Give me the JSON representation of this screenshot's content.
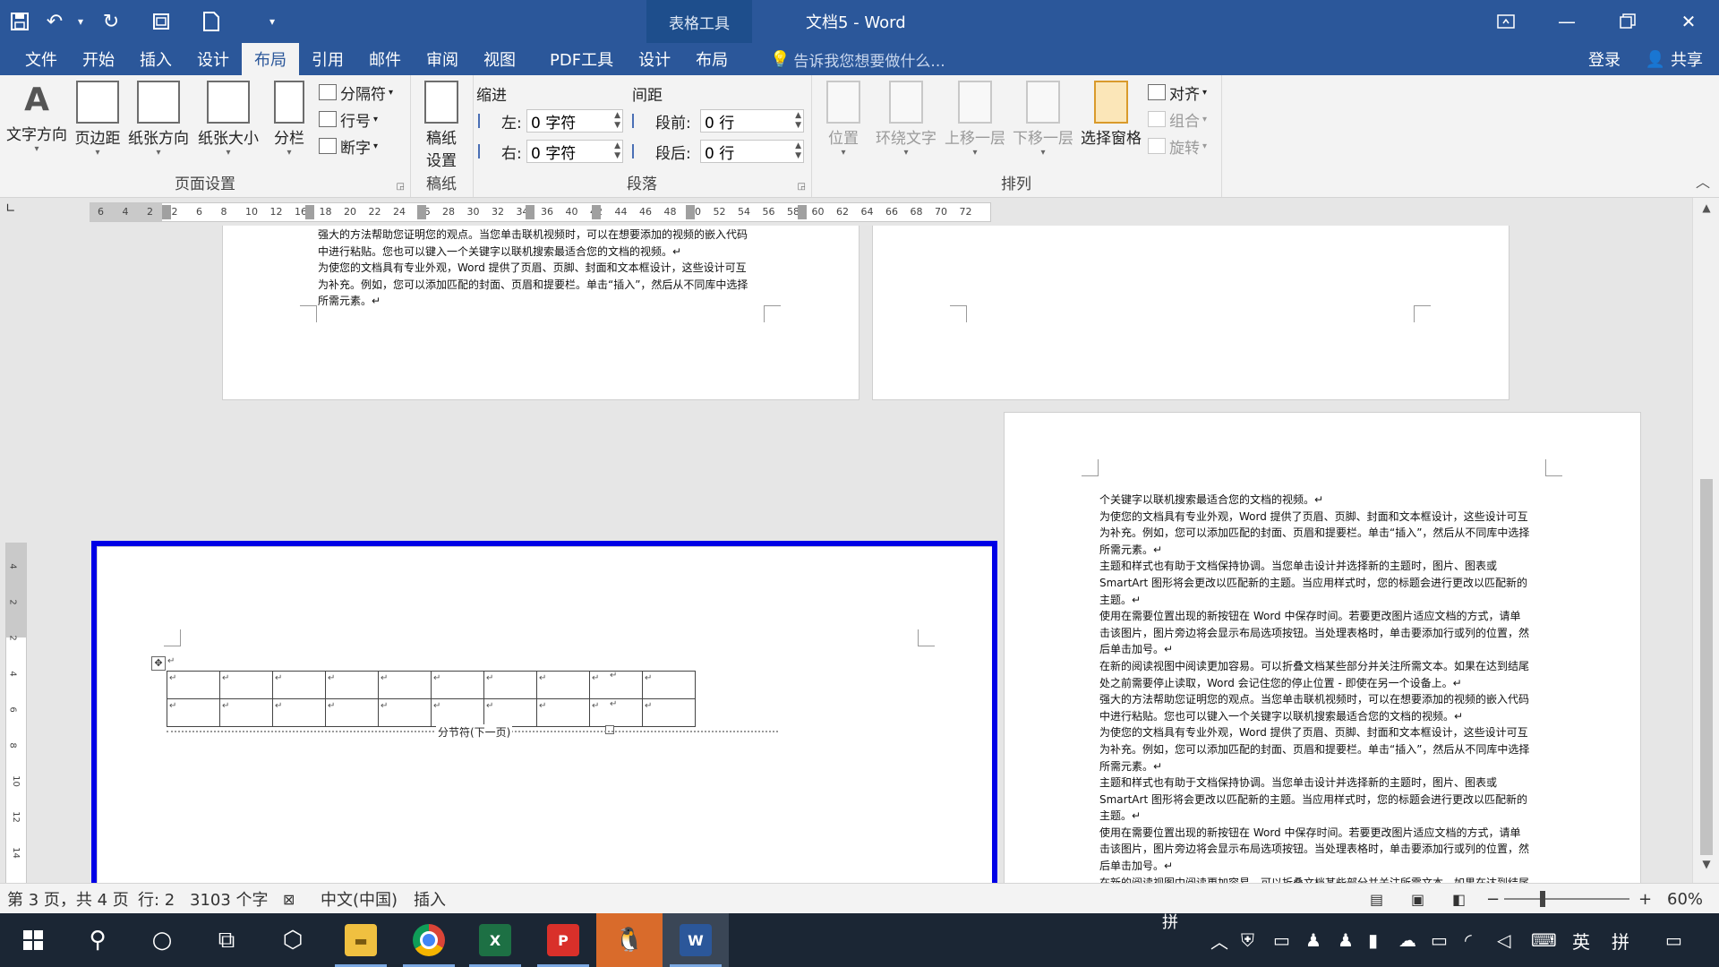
{
  "titlebar": {
    "context_tab": "表格工具",
    "title": "文档5 - Word"
  },
  "menu": {
    "tabs": [
      "文件",
      "开始",
      "插入",
      "设计",
      "布局",
      "引用",
      "邮件",
      "审阅",
      "视图",
      "PDF工具",
      "设计",
      "布局"
    ],
    "active_index": 4,
    "tell_me": "告诉我您想要做什么...",
    "sign_in": "登录",
    "share": "共享"
  },
  "ribbon": {
    "page_setup": {
      "label": "页面设置",
      "text_direction": "文字方向",
      "margins": "页边距",
      "orientation": "纸张方向",
      "size": "纸张大小",
      "columns": "分栏",
      "breaks": "分隔符",
      "line_numbers": "行号",
      "hyphenation": "断字"
    },
    "draft_paper": {
      "label": "稿纸",
      "button_line1": "稿纸",
      "button_line2": "设置"
    },
    "paragraph": {
      "label": "段落",
      "indent_title": "缩进",
      "spacing_title": "间距",
      "left_label": "左:",
      "left_value": "0 字符",
      "right_label": "右:",
      "right_value": "0 字符",
      "before_label": "段前:",
      "before_value": "0 行",
      "after_label": "段后:",
      "after_value": "0 行"
    },
    "arrange": {
      "label": "排列",
      "position": "位置",
      "wrap_text": "环绕文字",
      "bring_forward": "上移一层",
      "send_backward": "下移一层",
      "selection_pane": "选择窗格",
      "align": "对齐",
      "group": "组合",
      "rotate": "旋转"
    }
  },
  "ruler": {
    "ticks": [
      "6",
      "4",
      "2",
      "2",
      "6",
      "8",
      "10",
      "12",
      "16",
      "18",
      "20",
      "22",
      "24",
      "26",
      "28",
      "30",
      "32",
      "34",
      "36",
      "40",
      "42",
      "44",
      "46",
      "48",
      "50",
      "52",
      "54",
      "56",
      "58",
      "60",
      "62",
      "64",
      "66",
      "68",
      "70",
      "72"
    ]
  },
  "vruler": {
    "marks": [
      "4",
      "2",
      "2",
      "4",
      "6",
      "8",
      "10",
      "12",
      "14"
    ]
  },
  "pages": {
    "top_left_text": [
      "强大的方法帮助您证明您的观点。当您单击联机视频时，可以在想要添加的视频的嵌入代码",
      "中进行粘贴。您也可以键入一个关键字以联机搜索最适合您的文档的视频。↵",
      "为使您的文档具有专业外观，Word 提供了页眉、页脚、封面和文本框设计，这些设计可互",
      "为补充。例如，您可以添加匹配的封面、页眉和提要栏。单击“插入”，然后从不同库中选择",
      "所需元素。↵"
    ],
    "right_text": [
      "个关键字以联机搜索最适合您的文档的视频。↵",
      "为使您的文档具有专业外观，Word 提供了页眉、页脚、封面和文本框设计，这些设计可互",
      "为补充。例如，您可以添加匹配的封面、页眉和提要栏。单击“插入”，然后从不同库中选择",
      "所需元素。↵",
      "主题和样式也有助于文档保持协调。当您单击设计并选择新的主题时，图片、图表或",
      "SmartArt 图形将会更改以匹配新的主题。当应用样式时，您的标题会进行更改以匹配新的",
      "主题。↵",
      "使用在需要位置出现的新按钮在 Word 中保存时间。若要更改图片适应文档的方式，请单",
      "击该图片，图片旁边将会显示布局选项按钮。当处理表格时，单击要添加行或列的位置，然",
      "后单击加号。↵",
      "在新的阅读视图中阅读更加容易。可以折叠文档某些部分并关注所需文本。如果在达到结尾",
      "处之前需要停止读取，Word 会记住您的停止位置 - 即使在另一个设备上。↵",
      "强大的方法帮助您证明您的观点。当您单击联机视频时，可以在想要添加的视频的嵌入代码",
      "中进行粘贴。您也可以键入一个关键字以联机搜索最适合您的文档的视频。↵",
      "为使您的文档具有专业外观，Word 提供了页眉、页脚、封面和文本框设计，这些设计可互",
      "为补充。例如，您可以添加匹配的封面、页眉和提要栏。单击“插入”，然后从不同库中选择",
      "所需元素。↵",
      "主题和样式也有助于文档保持协调。当您单击设计并选择新的主题时，图片、图表或",
      "SmartArt 图形将会更改以匹配新的主题。当应用样式时，您的标题会进行更改以匹配新的",
      "主题。↵",
      "使用在需要位置出现的新按钮在 Word 中保存时间。若要更改图片适应文档的方式，请单",
      "击该图片，图片旁边将会显示布局选项按钮。当处理表格时，单击要添加行或列的位置，然",
      "后单击加号。↵",
      "在新的阅读视图中阅读更加容易。可以折叠文档某些部分并关注所需文本。如果在达到结尾"
    ],
    "para_mark": "↵",
    "cell_mark": "↵",
    "section_break": "分节符(下一页)",
    "table_rows": 2,
    "table_cols": 10
  },
  "status": {
    "page": "第 3 页，共 4 页",
    "line": "行: 2",
    "words": "3103 个字",
    "language": "中文(中国)",
    "mode": "插入",
    "zoom": "60%",
    "zoom_minus": "−",
    "zoom_plus": "+"
  },
  "taskbar": {
    "excel": "X",
    "pdf": "P",
    "word": "W",
    "ime_top": "拼",
    "ime_lang": "英",
    "ime_mode": "拼"
  },
  "colors": {
    "brand": "#2b579a",
    "highlight": "#0000e6"
  }
}
